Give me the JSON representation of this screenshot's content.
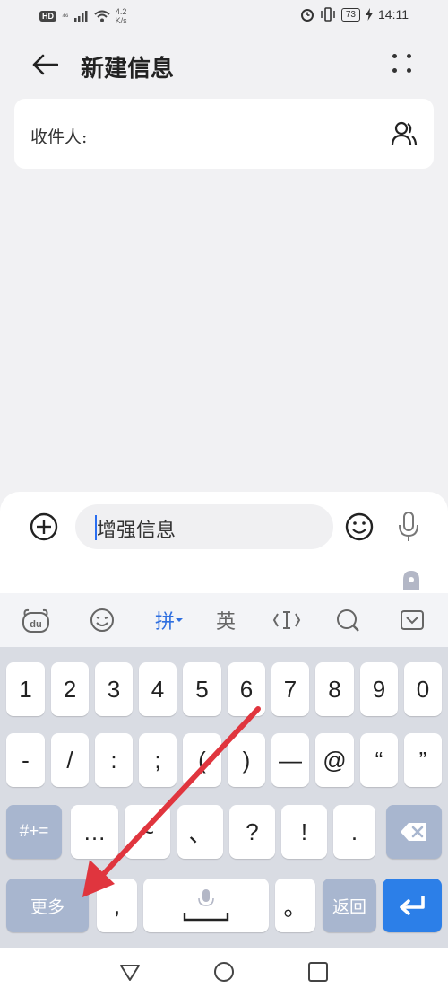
{
  "status_bar": {
    "hd": "HD",
    "network": "⁴⁶",
    "speed_value": "4.2",
    "speed_unit": "K/s",
    "battery": "73",
    "time": "14:11"
  },
  "header": {
    "title": "新建信息"
  },
  "recipient": {
    "label": "收件人:"
  },
  "composer": {
    "placeholder": "增强信息"
  },
  "toolbar": {
    "pinyin": "拼",
    "english": "英"
  },
  "keyboard": {
    "row1": [
      "1",
      "2",
      "3",
      "4",
      "5",
      "6",
      "7",
      "8",
      "9",
      "0"
    ],
    "row2": [
      "-",
      "/",
      ":",
      ";",
      "(",
      ")",
      "—",
      "@",
      "“",
      "”"
    ],
    "row3": [
      "#+=",
      "…",
      "~",
      "、",
      "?",
      "!",
      ".",
      ""
    ],
    "row4": {
      "more": "更多",
      "comma": ",",
      "period": "。",
      "back": "返回"
    }
  },
  "colors": {
    "accent": "#2c7fe8",
    "fn_key": "#a8b6cf",
    "annotation_arrow": "#e0353e"
  }
}
